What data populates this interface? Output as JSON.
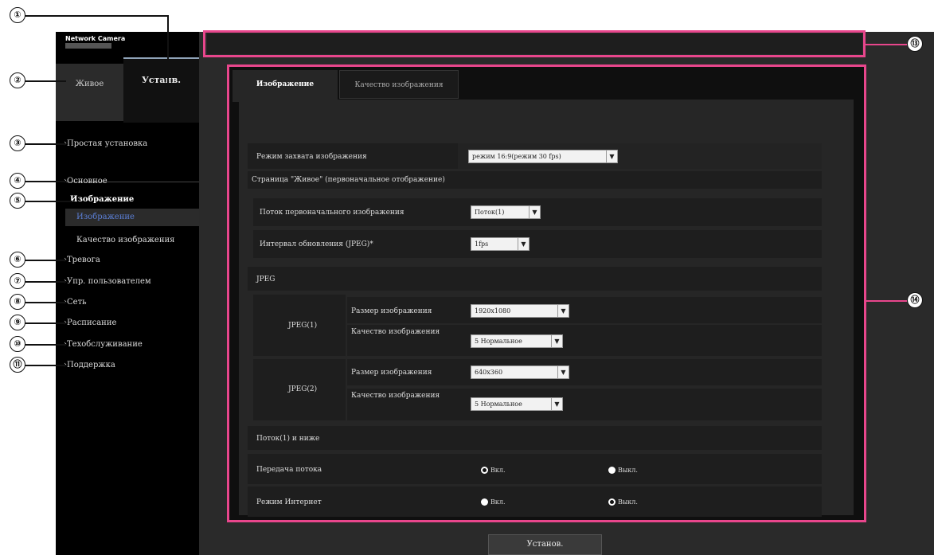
{
  "header": {
    "brand": "Network Camera",
    "page_path": ""
  },
  "nav_tabs": {
    "live": "Живое",
    "setup": "Устанв."
  },
  "sidebar": {
    "easy_setup": "›Простая установка",
    "basic": "›Основное",
    "image": "Изображение",
    "image_sub": [
      "Изображение",
      "Качество изображения"
    ],
    "multiscreen": "›Тревога",
    "user_mng": "›Упр. пользователем",
    "network": "›Сеть",
    "schedule": "›Расписание",
    "maintenance": "›Техобслуживание",
    "support": "›Поддержка"
  },
  "tabs": [
    "Изображение",
    "Качество изображения"
  ],
  "form": {
    "capture_mode_label": "Режим захвата изображения",
    "capture_mode_value": "режим 16:9(режим 30 fps)",
    "live_section": "Страница \"Живое\" (первоначальное отображение)",
    "stream_label": "Поток первоначального изображения",
    "stream_value": "Поток(1)",
    "refresh_label": "Интервал обновления (JPEG)*",
    "refresh_value": "1fps",
    "jpeg_section": "JPEG",
    "jpeg1": "JPEG(1)",
    "jpeg2": "JPEG(2)",
    "image_size_label": "Размер изображения",
    "image_quality_label": "Качество изображения",
    "jpeg1_size": "1920x1080",
    "jpeg1_quality": "5 Нормальное",
    "jpeg2_size": "640x360",
    "jpeg2_quality": "5 Нормальное",
    "stream_section": "Поток(1) и ниже",
    "stream_tx_label": "Передача потока",
    "internet_label": "Режим Интернет",
    "on": "Вкл.",
    "off": "Выкл.",
    "stream_tx_selected": "on",
    "internet_selected": "off"
  },
  "footer": {
    "set_button": "Установ."
  },
  "callouts": [
    "①",
    "②",
    "③",
    "④",
    "⑤",
    "⑥",
    "⑦",
    "⑧",
    "⑨",
    "⑩",
    "⑪",
    "⑬",
    "⑭"
  ],
  "colors": {
    "highlight": "#e8468c",
    "frame": "#000000",
    "content": "#262626"
  }
}
